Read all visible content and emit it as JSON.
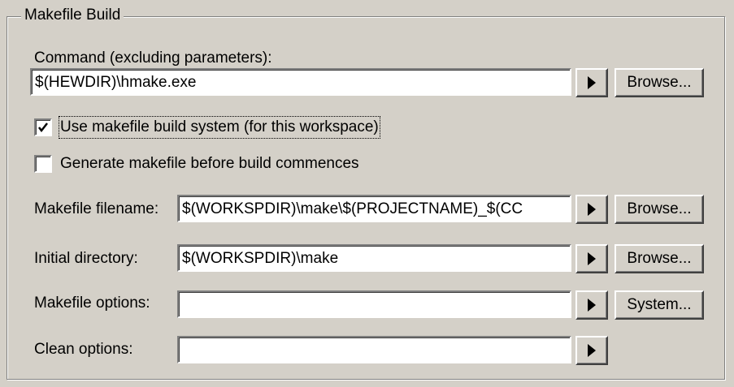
{
  "group": {
    "title": "Makefile Build"
  },
  "command": {
    "label": "Command (excluding parameters):",
    "value": "$(HEWDIR)\\hmake.exe",
    "browse_label": "Browse..."
  },
  "use_makefile": {
    "label": "Use makefile build system (for this workspace)",
    "checked": true
  },
  "generate_makefile": {
    "label": "Generate makefile before build commences",
    "checked": false
  },
  "makefile_filename": {
    "label": "Makefile filename:",
    "value": "$(WORKSPDIR)\\make\\$(PROJECTNAME)_$(CC",
    "browse_label": "Browse..."
  },
  "initial_directory": {
    "label": "Initial directory:",
    "value": "$(WORKSPDIR)\\make",
    "browse_label": "Browse..."
  },
  "makefile_options": {
    "label": "Makefile options:",
    "value": "",
    "system_label": "System..."
  },
  "clean_options": {
    "label": "Clean options:",
    "value": ""
  },
  "icons": {
    "arrow": "right-triangle-icon",
    "check": "checkmark-icon"
  }
}
